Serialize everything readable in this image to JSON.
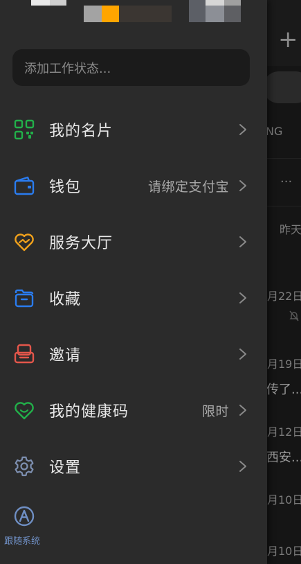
{
  "background": {
    "tab_fragment": "NG",
    "times": [
      "昨天",
      "月22日",
      "月19日",
      "月12日",
      "月10日",
      "月10日"
    ],
    "snippets": [
      "传了...",
      "西安..."
    ],
    "more": "···"
  },
  "drawer": {
    "status_placeholder": "添加工作状态...",
    "menu": [
      {
        "label": "我的名片",
        "value": "",
        "icon": "qr-code-icon",
        "color": "#22b04a"
      },
      {
        "label": "钱包",
        "value": "请绑定支付宝",
        "icon": "wallet-icon",
        "color": "#2a7cf0"
      },
      {
        "label": "服务大厅",
        "value": "",
        "icon": "heart-handshake-icon",
        "color": "#f2a21b"
      },
      {
        "label": "收藏",
        "value": "",
        "icon": "folder-icon",
        "color": "#2a7cf0"
      },
      {
        "label": "邀请",
        "value": "",
        "icon": "invite-icon",
        "color": "#e4564b"
      },
      {
        "label": "我的健康码",
        "value": "限时",
        "icon": "heart-smile-icon",
        "color": "#22b04a"
      },
      {
        "label": "设置",
        "value": "",
        "icon": "gear-icon",
        "color": "#7d8fb0"
      }
    ],
    "theme": {
      "label": "跟随系统",
      "icon": "auto-theme-icon",
      "color": "#6f8fc4"
    }
  }
}
